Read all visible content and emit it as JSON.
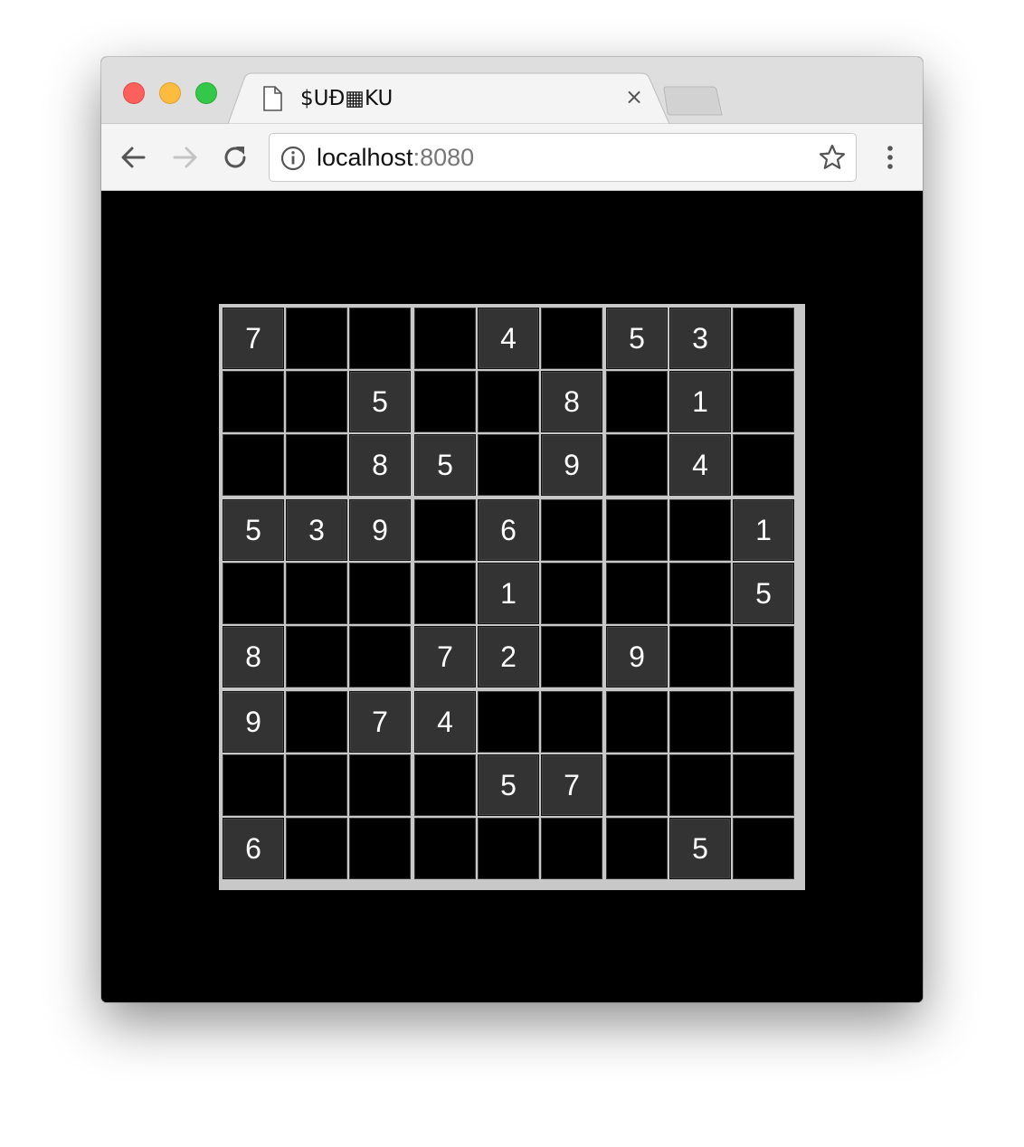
{
  "browser": {
    "tab": {
      "title": "$UÐ▦KU",
      "close_label": "×",
      "icon": "document-icon"
    },
    "address": {
      "host": "localhost",
      "port": ":8080"
    },
    "icons": {
      "back": "back-arrow-icon",
      "forward": "forward-arrow-icon",
      "reload": "reload-icon",
      "info": "info-icon",
      "bookmark": "star-icon",
      "menu": "kebab-menu-icon"
    }
  },
  "colors": {
    "page_background": "#000000",
    "board_lines": "#c8c8c8",
    "given_cell": "#333333",
    "digit": "#ffffff"
  },
  "sudoku": {
    "grid": [
      [
        7,
        0,
        0,
        0,
        4,
        0,
        5,
        3,
        0
      ],
      [
        0,
        0,
        5,
        0,
        0,
        8,
        0,
        1,
        0
      ],
      [
        0,
        0,
        8,
        5,
        0,
        9,
        0,
        4,
        0
      ],
      [
        5,
        3,
        9,
        0,
        6,
        0,
        0,
        0,
        1
      ],
      [
        0,
        0,
        0,
        0,
        1,
        0,
        0,
        0,
        5
      ],
      [
        8,
        0,
        0,
        7,
        2,
        0,
        9,
        0,
        0
      ],
      [
        9,
        0,
        7,
        4,
        0,
        0,
        0,
        0,
        0
      ],
      [
        0,
        0,
        0,
        0,
        5,
        7,
        0,
        0,
        0
      ],
      [
        6,
        0,
        0,
        0,
        0,
        0,
        0,
        5,
        0
      ]
    ]
  }
}
